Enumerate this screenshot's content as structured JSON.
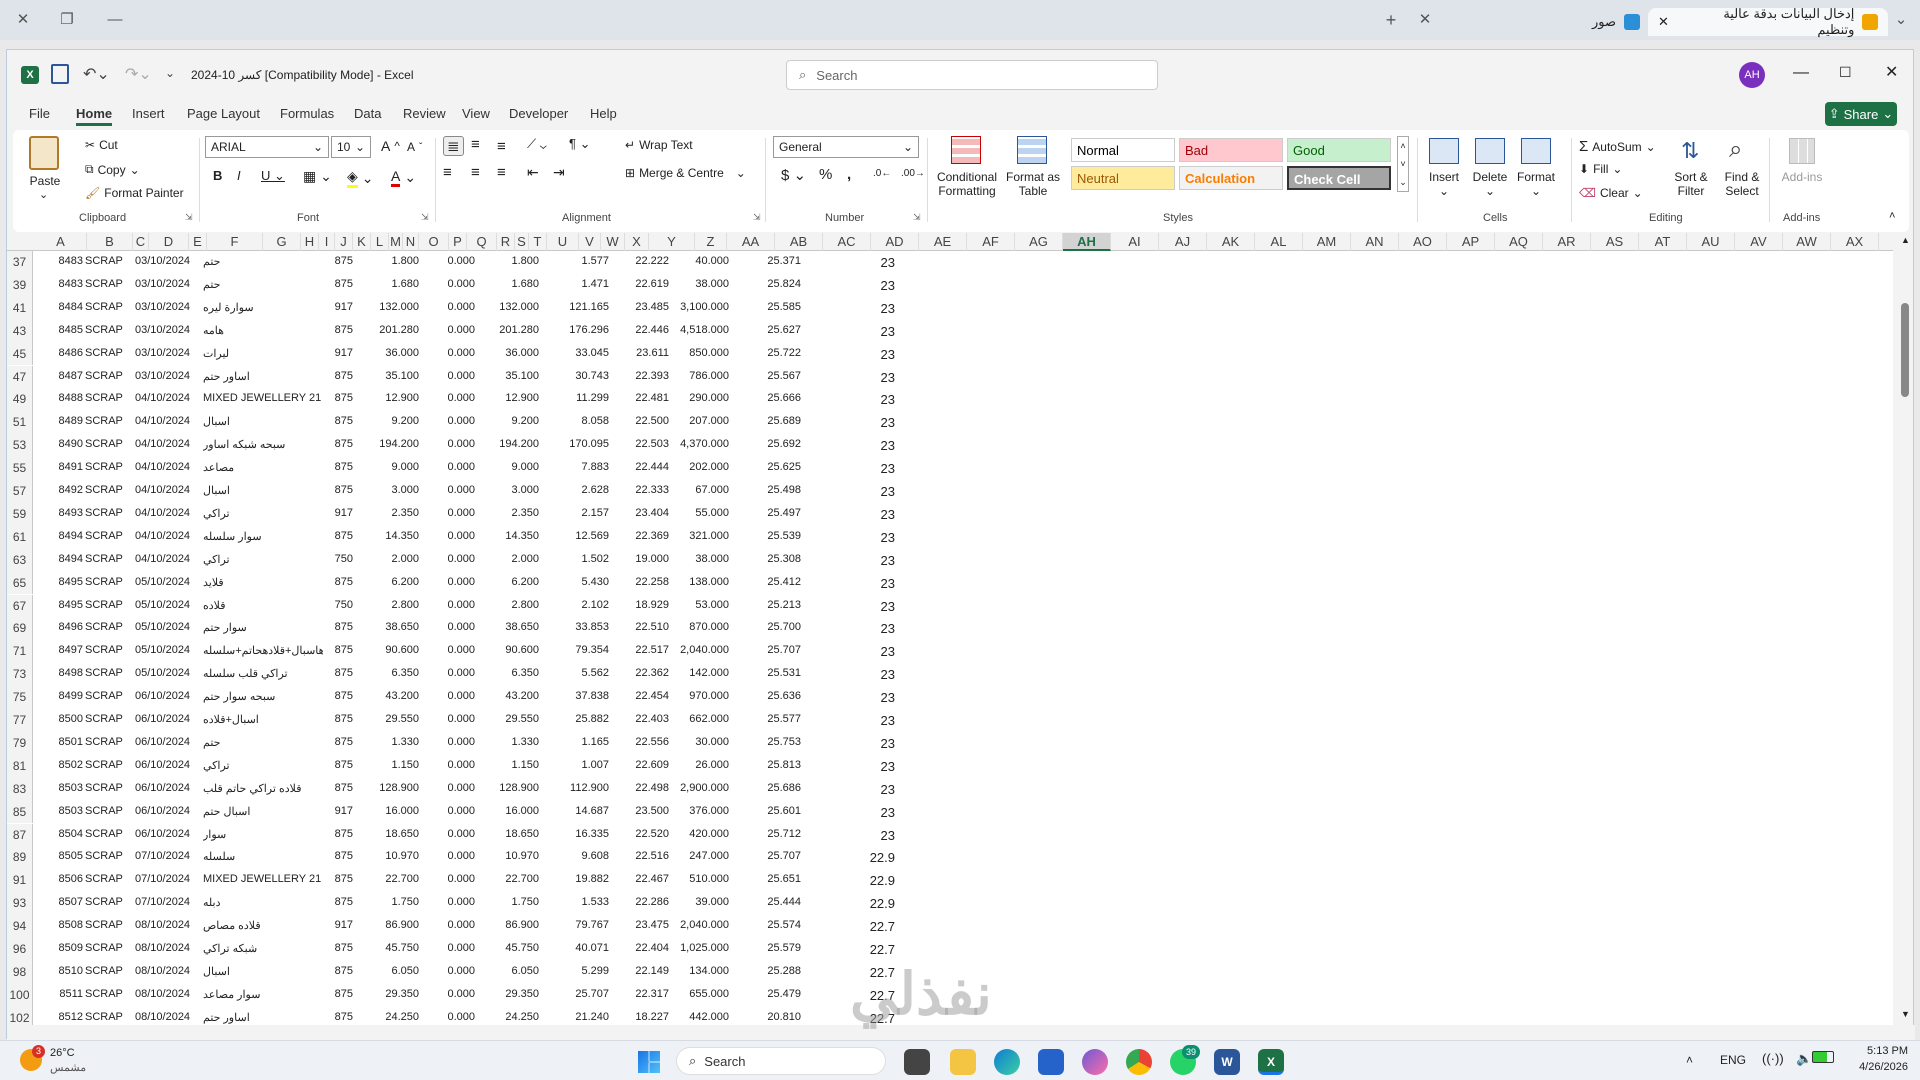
{
  "browser": {
    "tabs": [
      {
        "title": "إدخال البيانات بدقة عالية وتنظيم",
        "active": true
      },
      {
        "title": "صور",
        "active": false
      }
    ]
  },
  "excel": {
    "title": "كسر 10-2024  [Compatibility Mode]  -  Excel",
    "search_placeholder": "Search",
    "user_initials": "AH",
    "share_label": "Share",
    "menu": [
      "File",
      "Home",
      "Insert",
      "Page Layout",
      "Formulas",
      "Data",
      "Review",
      "View",
      "Developer",
      "Help"
    ],
    "active_menu": "Home",
    "ribbon": {
      "clipboard": {
        "paste": "Paste",
        "cut": "Cut",
        "copy": "Copy",
        "format_painter": "Format Painter",
        "label": "Clipboard"
      },
      "font": {
        "name": "ARIAL",
        "size": "10",
        "label": "Font"
      },
      "alignment": {
        "wrap": "Wrap Text",
        "merge": "Merge & Centre",
        "label": "Alignment"
      },
      "number": {
        "format": "General",
        "label": "Number"
      },
      "styles": {
        "conditional": "Conditional Formatting",
        "format_table": "Format as Table",
        "cells": [
          {
            "name": "Normal",
            "bg": "#ffffff",
            "fg": "#000000"
          },
          {
            "name": "Bad",
            "bg": "#ffc7ce",
            "fg": "#9c0006"
          },
          {
            "name": "Good",
            "bg": "#c6efce",
            "fg": "#006100"
          },
          {
            "name": "Neutral",
            "bg": "#ffeb9c",
            "fg": "#9c5700"
          },
          {
            "name": "Calculation",
            "bg": "#f2f2f2",
            "fg": "#fa7d00"
          },
          {
            "name": "Check Cell",
            "bg": "#a5a5a5",
            "fg": "#ffffff"
          }
        ],
        "label": "Styles"
      },
      "cells": {
        "insert": "Insert",
        "delete": "Delete",
        "format": "Format",
        "label": "Cells"
      },
      "editing": {
        "autosum": "AutoSum",
        "fill": "Fill",
        "clear": "Clear",
        "sort": "Sort & Filter",
        "find": "Find & Select",
        "label": "Editing"
      },
      "addins": {
        "label": "Add-ins",
        "button": "Add-ins"
      }
    },
    "columns": [
      "A",
      "B",
      "C",
      "D",
      "E",
      "F",
      "G",
      "H",
      "I",
      "J",
      "K",
      "L",
      "M",
      "N",
      "O",
      "P",
      "Q",
      "R",
      "S",
      "T",
      "U",
      "V",
      "W",
      "X",
      "Y",
      "Z",
      "AA",
      "AB",
      "AC",
      "AD",
      "AE",
      "AF",
      "AG",
      "AH",
      "AI",
      "AJ",
      "AK",
      "AL",
      "AM",
      "AN",
      "AO",
      "AP",
      "AQ",
      "AR",
      "AS",
      "AT",
      "AU",
      "AV",
      "AW",
      "AX"
    ],
    "selected_column": "AH",
    "rows": [
      {
        "n": "37",
        "a": "8483",
        "b": "SCRAP",
        "d": "03/10/2024",
        "e": "حتم",
        "i": "875",
        "l": "1.800",
        "o": "0.000",
        "q": "1.800",
        "u": "1.577",
        "w": "22.222",
        "y": "40.000",
        "aa": "25.371",
        "ac": "23"
      },
      {
        "n": "39",
        "a": "8483",
        "b": "SCRAP",
        "d": "03/10/2024",
        "e": "حتم",
        "i": "875",
        "l": "1.680",
        "o": "0.000",
        "q": "1.680",
        "u": "1.471",
        "w": "22.619",
        "y": "38.000",
        "aa": "25.824",
        "ac": "23"
      },
      {
        "n": "41",
        "a": "8484",
        "b": "SCRAP",
        "d": "03/10/2024",
        "e": "سوارة ليره",
        "i": "917",
        "l": "132.000",
        "o": "0.000",
        "q": "132.000",
        "u": "121.165",
        "w": "23.485",
        "y": "3,100.000",
        "aa": "25.585",
        "ac": "23"
      },
      {
        "n": "43",
        "a": "8485",
        "b": "SCRAP",
        "d": "03/10/2024",
        "e": "هامه",
        "i": "875",
        "l": "201.280",
        "o": "0.000",
        "q": "201.280",
        "u": "176.296",
        "w": "22.446",
        "y": "4,518.000",
        "aa": "25.627",
        "ac": "23"
      },
      {
        "n": "45",
        "a": "8486",
        "b": "SCRAP",
        "d": "03/10/2024",
        "e": "ليرات",
        "i": "917",
        "l": "36.000",
        "o": "0.000",
        "q": "36.000",
        "u": "33.045",
        "w": "23.611",
        "y": "850.000",
        "aa": "25.722",
        "ac": "23"
      },
      {
        "n": "47",
        "a": "8487",
        "b": "SCRAP",
        "d": "03/10/2024",
        "e": "اساور حتم",
        "i": "875",
        "l": "35.100",
        "o": "0.000",
        "q": "35.100",
        "u": "30.743",
        "w": "22.393",
        "y": "786.000",
        "aa": "25.567",
        "ac": "23"
      },
      {
        "n": "49",
        "a": "8488",
        "b": "SCRAP",
        "d": "04/10/2024",
        "e": "MIXED JEWELLERY 21",
        "i": "875",
        "l": "12.900",
        "o": "0.000",
        "q": "12.900",
        "u": "11.299",
        "w": "22.481",
        "y": "290.000",
        "aa": "25.666",
        "ac": "23"
      },
      {
        "n": "51",
        "a": "8489",
        "b": "SCRAP",
        "d": "04/10/2024",
        "e": "اسبال",
        "i": "875",
        "l": "9.200",
        "o": "0.000",
        "q": "9.200",
        "u": "8.058",
        "w": "22.500",
        "y": "207.000",
        "aa": "25.689",
        "ac": "23"
      },
      {
        "n": "53",
        "a": "8490",
        "b": "SCRAP",
        "d": "04/10/2024",
        "e": "سبحه شبكه اساور",
        "i": "875",
        "l": "194.200",
        "o": "0.000",
        "q": "194.200",
        "u": "170.095",
        "w": "22.503",
        "y": "4,370.000",
        "aa": "25.692",
        "ac": "23"
      },
      {
        "n": "55",
        "a": "8491",
        "b": "SCRAP",
        "d": "04/10/2024",
        "e": "مصاعد",
        "i": "875",
        "l": "9.000",
        "o": "0.000",
        "q": "9.000",
        "u": "7.883",
        "w": "22.444",
        "y": "202.000",
        "aa": "25.625",
        "ac": "23"
      },
      {
        "n": "57",
        "a": "8492",
        "b": "SCRAP",
        "d": "04/10/2024",
        "e": "اسبال",
        "i": "875",
        "l": "3.000",
        "o": "0.000",
        "q": "3.000",
        "u": "2.628",
        "w": "22.333",
        "y": "67.000",
        "aa": "25.498",
        "ac": "23"
      },
      {
        "n": "59",
        "a": "8493",
        "b": "SCRAP",
        "d": "04/10/2024",
        "e": "تراكي",
        "i": "917",
        "l": "2.350",
        "o": "0.000",
        "q": "2.350",
        "u": "2.157",
        "w": "23.404",
        "y": "55.000",
        "aa": "25.497",
        "ac": "23"
      },
      {
        "n": "61",
        "a": "8494",
        "b": "SCRAP",
        "d": "04/10/2024",
        "e": "سوار سلسله",
        "i": "875",
        "l": "14.350",
        "o": "0.000",
        "q": "14.350",
        "u": "12.569",
        "w": "22.369",
        "y": "321.000",
        "aa": "25.539",
        "ac": "23"
      },
      {
        "n": "63",
        "a": "8494",
        "b": "SCRAP",
        "d": "04/10/2024",
        "e": "تراكي",
        "i": "750",
        "l": "2.000",
        "o": "0.000",
        "q": "2.000",
        "u": "1.502",
        "w": "19.000",
        "y": "38.000",
        "aa": "25.308",
        "ac": "23"
      },
      {
        "n": "65",
        "a": "8495",
        "b": "SCRAP",
        "d": "05/10/2024",
        "e": "قلايد",
        "i": "875",
        "l": "6.200",
        "o": "0.000",
        "q": "6.200",
        "u": "5.430",
        "w": "22.258",
        "y": "138.000",
        "aa": "25.412",
        "ac": "23"
      },
      {
        "n": "67",
        "a": "8495",
        "b": "SCRAP",
        "d": "05/10/2024",
        "e": "قلاده",
        "i": "750",
        "l": "2.800",
        "o": "0.000",
        "q": "2.800",
        "u": "2.102",
        "w": "18.929",
        "y": "53.000",
        "aa": "25.213",
        "ac": "23"
      },
      {
        "n": "69",
        "a": "8496",
        "b": "SCRAP",
        "d": "05/10/2024",
        "e": "سوار حتم",
        "i": "875",
        "l": "38.650",
        "o": "0.000",
        "q": "38.650",
        "u": "33.853",
        "w": "22.510",
        "y": "870.000",
        "aa": "25.700",
        "ac": "23"
      },
      {
        "n": "71",
        "a": "8497",
        "b": "SCRAP",
        "d": "05/10/2024",
        "e": "عدهاسبال+قلادهحاتم+سلسله",
        "i": "875",
        "l": "90.600",
        "o": "0.000",
        "q": "90.600",
        "u": "79.354",
        "w": "22.517",
        "y": "2,040.000",
        "aa": "25.707",
        "ac": "23"
      },
      {
        "n": "73",
        "a": "8498",
        "b": "SCRAP",
        "d": "05/10/2024",
        "e": "تراكي قلب سلسله",
        "i": "875",
        "l": "6.350",
        "o": "0.000",
        "q": "6.350",
        "u": "5.562",
        "w": "22.362",
        "y": "142.000",
        "aa": "25.531",
        "ac": "23"
      },
      {
        "n": "75",
        "a": "8499",
        "b": "SCRAP",
        "d": "06/10/2024",
        "e": "سبحه سوار حتم",
        "i": "875",
        "l": "43.200",
        "o": "0.000",
        "q": "43.200",
        "u": "37.838",
        "w": "22.454",
        "y": "970.000",
        "aa": "25.636",
        "ac": "23"
      },
      {
        "n": "77",
        "a": "8500",
        "b": "SCRAP",
        "d": "06/10/2024",
        "e": "اسبال+قلاده",
        "i": "875",
        "l": "29.550",
        "o": "0.000",
        "q": "29.550",
        "u": "25.882",
        "w": "22.403",
        "y": "662.000",
        "aa": "25.577",
        "ac": "23"
      },
      {
        "n": "79",
        "a": "8501",
        "b": "SCRAP",
        "d": "06/10/2024",
        "e": "حتم",
        "i": "875",
        "l": "1.330",
        "o": "0.000",
        "q": "1.330",
        "u": "1.165",
        "w": "22.556",
        "y": "30.000",
        "aa": "25.753",
        "ac": "23"
      },
      {
        "n": "81",
        "a": "8502",
        "b": "SCRAP",
        "d": "06/10/2024",
        "e": "تراكي",
        "i": "875",
        "l": "1.150",
        "o": "0.000",
        "q": "1.150",
        "u": "1.007",
        "w": "22.609",
        "y": "26.000",
        "aa": "25.813",
        "ac": "23"
      },
      {
        "n": "83",
        "a": "8503",
        "b": "SCRAP",
        "d": "06/10/2024",
        "e": "قلاده تراكي حاتم قلب",
        "i": "875",
        "l": "128.900",
        "o": "0.000",
        "q": "128.900",
        "u": "112.900",
        "w": "22.498",
        "y": "2,900.000",
        "aa": "25.686",
        "ac": "23"
      },
      {
        "n": "85",
        "a": "8503",
        "b": "SCRAP",
        "d": "06/10/2024",
        "e": "اسبال حتم",
        "i": "917",
        "l": "16.000",
        "o": "0.000",
        "q": "16.000",
        "u": "14.687",
        "w": "23.500",
        "y": "376.000",
        "aa": "25.601",
        "ac": "23"
      },
      {
        "n": "87",
        "a": "8504",
        "b": "SCRAP",
        "d": "06/10/2024",
        "e": "سوار",
        "i": "875",
        "l": "18.650",
        "o": "0.000",
        "q": "18.650",
        "u": "16.335",
        "w": "22.520",
        "y": "420.000",
        "aa": "25.712",
        "ac": "23"
      },
      {
        "n": "89",
        "a": "8505",
        "b": "SCRAP",
        "d": "07/10/2024",
        "e": "سلسله",
        "i": "875",
        "l": "10.970",
        "o": "0.000",
        "q": "10.970",
        "u": "9.608",
        "w": "22.516",
        "y": "247.000",
        "aa": "25.707",
        "ac": "22.9"
      },
      {
        "n": "91",
        "a": "8506",
        "b": "SCRAP",
        "d": "07/10/2024",
        "e": "MIXED JEWELLERY 21",
        "i": "875",
        "l": "22.700",
        "o": "0.000",
        "q": "22.700",
        "u": "19.882",
        "w": "22.467",
        "y": "510.000",
        "aa": "25.651",
        "ac": "22.9"
      },
      {
        "n": "93",
        "a": "8507",
        "b": "SCRAP",
        "d": "07/10/2024",
        "e": "دبله",
        "i": "875",
        "l": "1.750",
        "o": "0.000",
        "q": "1.750",
        "u": "1.533",
        "w": "22.286",
        "y": "39.000",
        "aa": "25.444",
        "ac": "22.9"
      },
      {
        "n": "94",
        "a": "8508",
        "b": "SCRAP",
        "d": "08/10/2024",
        "e": "قلاده مصاص",
        "i": "917",
        "l": "86.900",
        "o": "0.000",
        "q": "86.900",
        "u": "79.767",
        "w": "23.475",
        "y": "2,040.000",
        "aa": "25.574",
        "ac": "22.7"
      },
      {
        "n": "96",
        "a": "8509",
        "b": "SCRAP",
        "d": "08/10/2024",
        "e": "شبكه تراكي",
        "i": "875",
        "l": "45.750",
        "o": "0.000",
        "q": "45.750",
        "u": "40.071",
        "w": "22.404",
        "y": "1,025.000",
        "aa": "25.579",
        "ac": "22.7"
      },
      {
        "n": "98",
        "a": "8510",
        "b": "SCRAP",
        "d": "08/10/2024",
        "e": "اسبال",
        "i": "875",
        "l": "6.050",
        "o": "0.000",
        "q": "6.050",
        "u": "5.299",
        "w": "22.149",
        "y": "134.000",
        "aa": "25.288",
        "ac": "22.7"
      },
      {
        "n": "100",
        "a": "8511",
        "b": "SCRAP",
        "d": "08/10/2024",
        "e": "سوار مصاعد",
        "i": "875",
        "l": "29.350",
        "o": "0.000",
        "q": "29.350",
        "u": "25.707",
        "w": "22.317",
        "y": "655.000",
        "aa": "25.479",
        "ac": "22.7"
      },
      {
        "n": "102",
        "a": "8512",
        "b": "SCRAP",
        "d": "08/10/2024",
        "e": "اساور حتم",
        "i": "875",
        "l": "24.250",
        "o": "0.000",
        "q": "24.250",
        "u": "21.240",
        "w": "18.227",
        "y": "442.000",
        "aa": "20.810",
        "ac": "22.7"
      }
    ]
  },
  "taskbar": {
    "weather_temp": "26°C",
    "weather_desc": "مشمس",
    "weather_badge": "3",
    "search": "Search",
    "whatsapp_badge": "39",
    "lang": "ENG",
    "time": "5:13 PM",
    "date": "4/26/2026"
  },
  "watermark": "نفذلي",
  "colors": {
    "excel_green": "#1e7145",
    "accent_blue": "#2b579a"
  }
}
